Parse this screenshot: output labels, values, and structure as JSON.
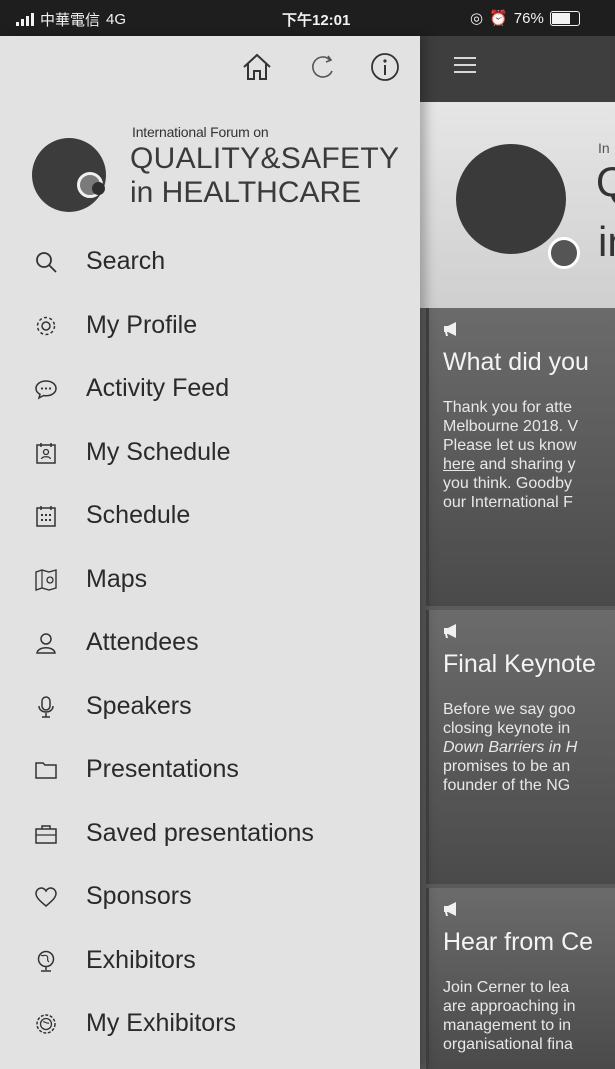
{
  "status_bar": {
    "carrier": "中華電信",
    "network": "4G",
    "time": "下午12:01",
    "battery": "76%",
    "battery_level": 0.76
  },
  "drawer": {
    "top_icons": [
      "home-icon",
      "refresh-icon",
      "info-icon"
    ],
    "logo": {
      "line1": "International Forum on",
      "line2": "QUALITY&SAFETY",
      "line3": "in HEALTHCARE"
    },
    "menu": [
      {
        "label": "Search",
        "icon": "search-icon"
      },
      {
        "label": "My Profile",
        "icon": "gear-icon"
      },
      {
        "label": "Activity Feed",
        "icon": "chat-bubble-icon"
      },
      {
        "label": "My Schedule",
        "icon": "calendar-person-icon"
      },
      {
        "label": "Schedule",
        "icon": "calendar-icon"
      },
      {
        "label": "Maps",
        "icon": "map-icon"
      },
      {
        "label": "Attendees",
        "icon": "person-icon"
      },
      {
        "label": "Speakers",
        "icon": "microphone-icon"
      },
      {
        "label": "Presentations",
        "icon": "folder-icon"
      },
      {
        "label": "Saved presentations",
        "icon": "briefcase-icon"
      },
      {
        "label": "Sponsors",
        "icon": "heart-icon"
      },
      {
        "label": "Exhibitors",
        "icon": "globe-icon"
      },
      {
        "label": "My Exhibitors",
        "icon": "globe-star-icon"
      }
    ]
  },
  "content": {
    "banner": {
      "line1": "In",
      "line2": "Q",
      "line3": "in"
    },
    "cards": [
      {
        "title": "What did you",
        "lines": [
          "Thank you for atte",
          "Melbourne 2018. V",
          "Please let us know",
          "here and sharing y",
          "you think. Goodby",
          "our International F"
        ]
      },
      {
        "title": "Final Keynote",
        "lines": [
          "Before we say goo",
          "closing keynote in",
          "Down Barriers in H",
          "promises to be an",
          "founder of the NG"
        ]
      },
      {
        "title": "Hear from Ce",
        "lines": [
          "Join Cerner to lea",
          "are approaching in",
          "management to in",
          "organisational fina"
        ]
      }
    ]
  },
  "colors": {
    "drawer_bg": "#e2e2e2",
    "content_bg": "#5b5b5b",
    "topbar_bg": "#3e3e3e",
    "status_bar_bg": "#1e1e1e"
  }
}
